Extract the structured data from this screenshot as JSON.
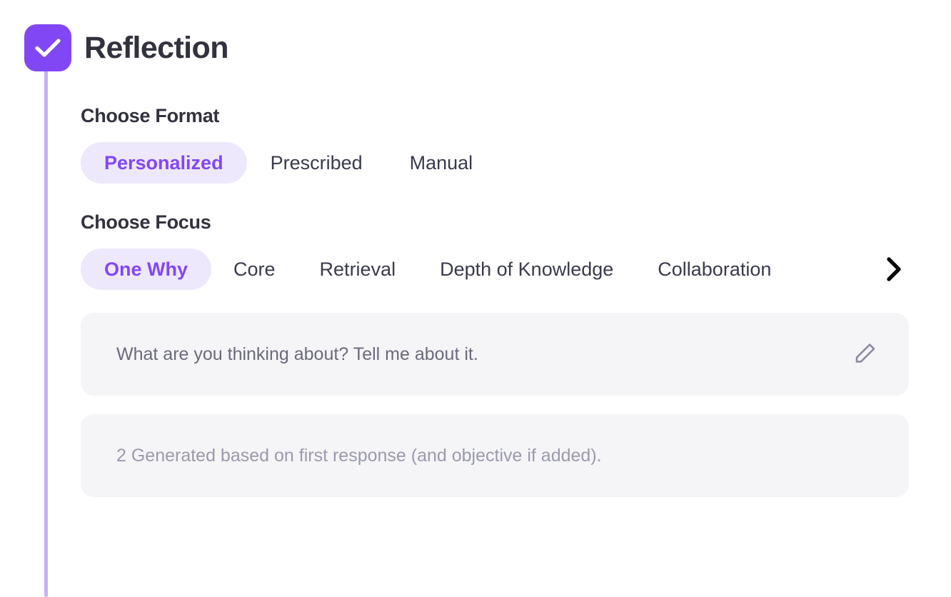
{
  "header": {
    "title": "Reflection",
    "checkbox_checked": true,
    "checkbox_color": "#8247F5",
    "connector_color": "#C6B2F7"
  },
  "format_section": {
    "heading": "Choose Format",
    "tabs": [
      {
        "label": "Personalized",
        "active": true
      },
      {
        "label": "Prescribed",
        "active": false
      },
      {
        "label": "Manual",
        "active": false
      }
    ]
  },
  "focus_section": {
    "heading": "Choose Focus",
    "tabs": [
      {
        "label": "One Why",
        "active": true
      },
      {
        "label": "Core",
        "active": false
      },
      {
        "label": "Retrieval",
        "active": false
      },
      {
        "label": "Depth of Knowledge",
        "active": false
      },
      {
        "label": "Collaboration",
        "active": false
      }
    ],
    "next_icon": "chevron-right-icon"
  },
  "prompts": [
    {
      "text": "What are you thinking about? Tell me about it.",
      "has_edit": true,
      "edit_icon": "pencil-icon",
      "muted": false
    },
    {
      "text": "2 Generated based on first response (and objective if added).",
      "has_edit": false,
      "muted": true
    }
  ],
  "colors": {
    "accent": "#8247F5",
    "accent_soft": "#EEE8FD",
    "card_bg": "#F5F5F8",
    "text_dark": "#32323F",
    "text_tab": "#3A3A4E",
    "text_prompt": "#6A6A7C",
    "text_muted": "#9A9AAD"
  }
}
